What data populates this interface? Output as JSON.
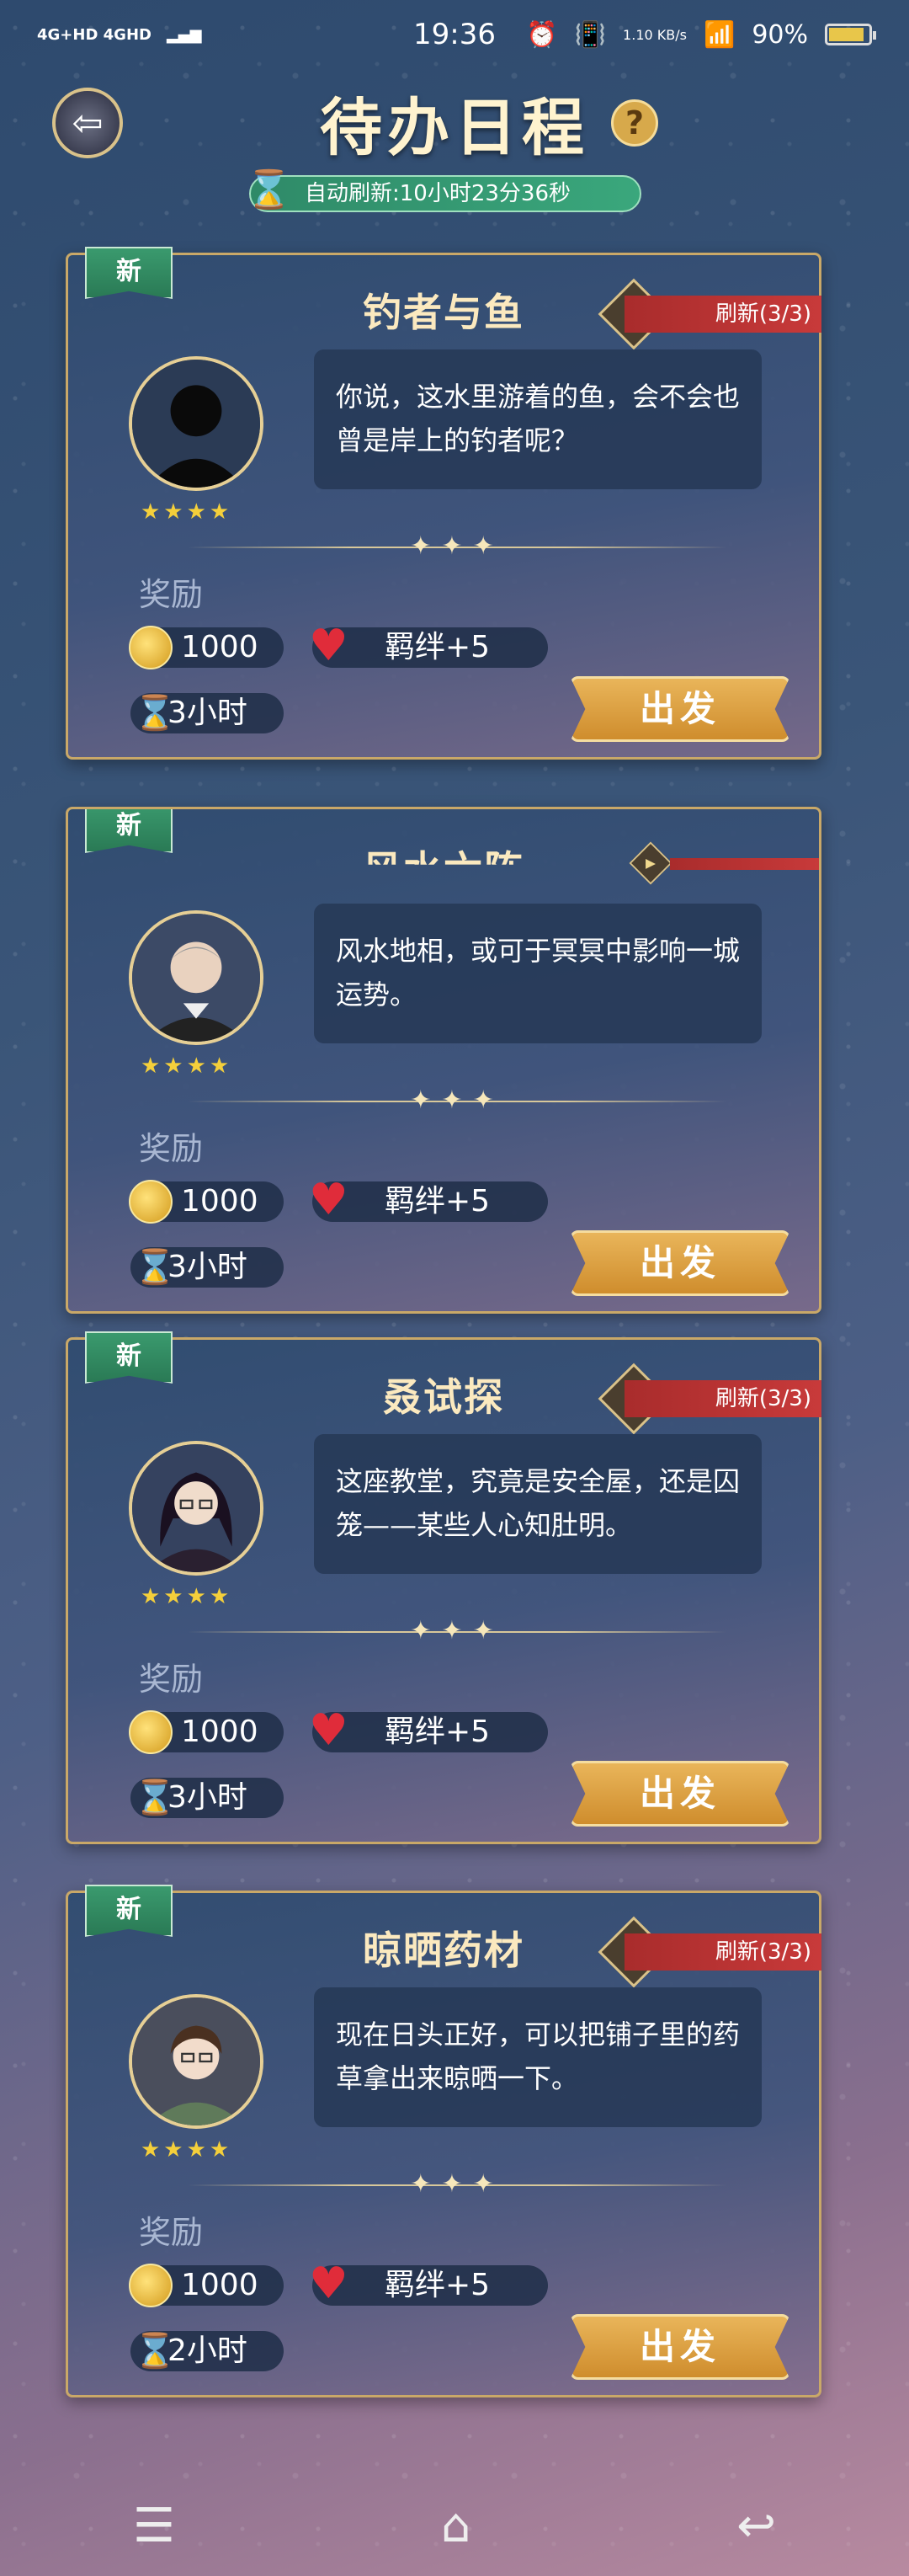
{
  "status_bar": {
    "network": "4G+HD 4GHD",
    "time": "19:36",
    "speed": "1.10 KB/s",
    "battery": "90%",
    "battery_level": 0.9
  },
  "header": {
    "title": "待办日程",
    "help_label": "?",
    "auto_refresh": "自动刷新:10小时23分36秒"
  },
  "cards": [
    {
      "new_tag": "新",
      "title": "钓者与鱼",
      "refresh": "刷新(3/3)",
      "stars": "★★★★",
      "dialogue": "你说，这水里游着的鱼，会不会也曾是岸上的钓者呢？",
      "reward_label": "奖励",
      "coins": "1000",
      "bond": "羁绊+5",
      "duration": "3小时",
      "depart": "出发"
    },
    {
      "new_tag": "新",
      "title": "风水六阵",
      "refresh": "",
      "stars": "★★★★",
      "dialogue": "风水地相，或可于冥冥中影响一城运势。",
      "reward_label": "奖励",
      "coins": "1000",
      "bond": "羁绊+5",
      "duration": "3小时",
      "depart": "出发"
    },
    {
      "new_tag": "新",
      "title": "叒试探",
      "refresh": "刷新(3/3)",
      "stars": "★★★★",
      "dialogue": "这座教堂，究竟是安全屋，还是囚笼——某些人心知肚明。",
      "reward_label": "奖励",
      "coins": "1000",
      "bond": "羁绊+5",
      "duration": "3小时",
      "depart": "出发"
    },
    {
      "new_tag": "新",
      "title": "晾晒药材",
      "refresh": "刷新(3/3)",
      "stars": "★★★★",
      "dialogue": "现在日头正好，可以把铺子里的药草拿出来晾晒一下。",
      "reward_label": "奖励",
      "coins": "1000",
      "bond": "羁绊+5",
      "duration": "2小时",
      "depart": "出发"
    }
  ],
  "icons": {
    "back": "back-arrow-icon",
    "hourglass": "hourglass-icon",
    "coin": "coin-icon",
    "heart": "heart-icon",
    "play": "play-icon",
    "menu": "menu-icon",
    "home": "home-icon",
    "return": "return-icon"
  },
  "colors": {
    "accent_gold": "#c9a868",
    "new_tag_green": "#3a9a6e",
    "refresh_red": "#c83a3a",
    "depart_orange": "#e9b55a"
  }
}
